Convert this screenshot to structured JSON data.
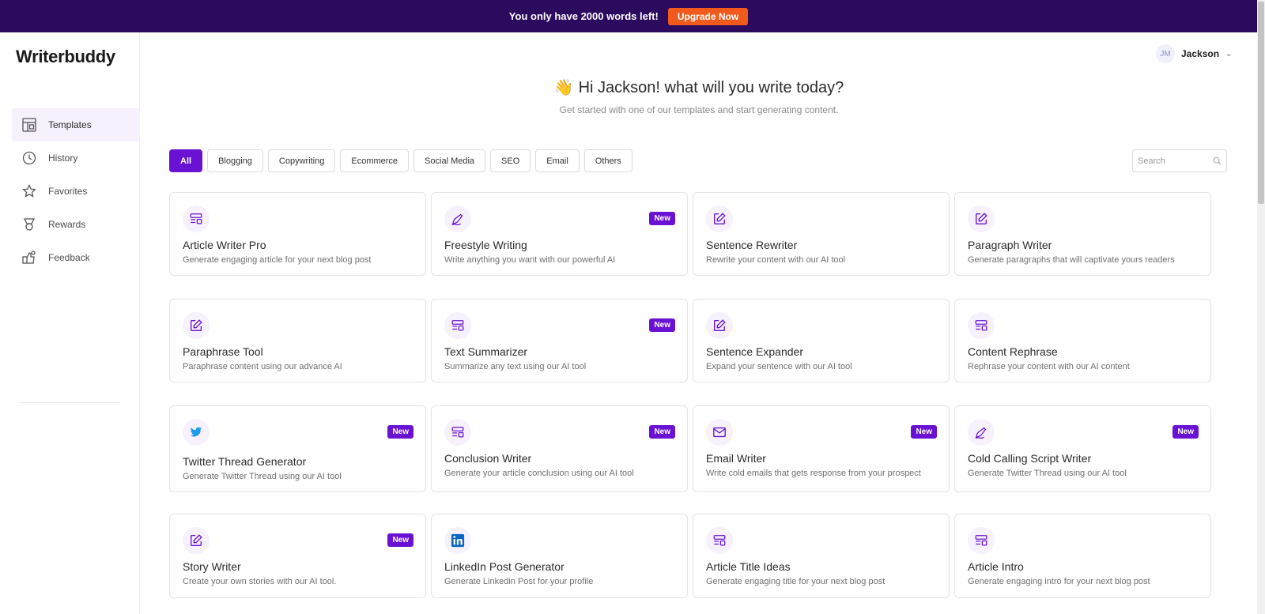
{
  "banner": {
    "message": "You only have 2000 words left!",
    "cta": "Upgrade Now"
  },
  "brand": {
    "name": "Writerbuddy"
  },
  "nav": [
    {
      "label": "Templates",
      "icon": "templates-icon"
    },
    {
      "label": "History",
      "icon": "history-icon"
    },
    {
      "label": "Favorites",
      "icon": "star-icon"
    },
    {
      "label": "Rewards",
      "icon": "medal-icon"
    },
    {
      "label": "Feedback",
      "icon": "feedback-icon"
    }
  ],
  "user": {
    "initials": "JM",
    "name": "Jackson"
  },
  "hero": {
    "wave": "👋",
    "title": "Hi Jackson! what will you write today?",
    "subtitle": "Get started with one of our templates and start generating content."
  },
  "filters": [
    "All",
    "Blogging",
    "Copywriting",
    "Ecommerce",
    "Social Media",
    "SEO",
    "Email",
    "Others"
  ],
  "search": {
    "placeholder": "Search"
  },
  "badge_label": "New",
  "cards": [
    {
      "title": "Article Writer Pro",
      "desc": "Generate engaging article for your next blog post",
      "icon": "layout-icon",
      "new": false
    },
    {
      "title": "Freestyle Writing",
      "desc": "Write anything you want with our powerful AI",
      "icon": "pen-nib-icon",
      "new": true
    },
    {
      "title": "Sentence Rewriter",
      "desc": "Rewrite your content with our AI tool",
      "icon": "edit-icon",
      "new": false
    },
    {
      "title": "Paragraph Writer",
      "desc": "Generate paragraphs that will captivate yours readers",
      "icon": "edit-icon",
      "new": false
    },
    {
      "title": "Paraphrase Tool",
      "desc": "Paraphrase content using our advance AI",
      "icon": "edit-icon",
      "new": false
    },
    {
      "title": "Text Summarizer",
      "desc": "Summarize any text using our AI tool",
      "icon": "layout-icon",
      "new": true
    },
    {
      "title": "Sentence Expander",
      "desc": "Expand your sentence with our AI tool",
      "icon": "edit-icon",
      "new": false
    },
    {
      "title": "Content Rephrase",
      "desc": "Rephrase your content with our AI content",
      "icon": "layout-icon",
      "new": false
    },
    {
      "title": "Twitter Thread Generator",
      "desc": "Generate Twitter Thread using our AI tool",
      "icon": "twitter-icon",
      "new": true
    },
    {
      "title": "Conclusion Writer",
      "desc": "Generate your article conclusion using our AI tool",
      "icon": "layout-icon",
      "new": true
    },
    {
      "title": "Email Writer",
      "desc": "Write cold emails that gets response from your prospect",
      "icon": "mail-icon",
      "new": true
    },
    {
      "title": "Cold Calling Script Writer",
      "desc": "Generate Twitter Thread using our AI tool",
      "icon": "pen-nib-icon",
      "new": true
    },
    {
      "title": "Story Writer",
      "desc": "Create your own stories with our AI tool.",
      "icon": "edit-icon",
      "new": true
    },
    {
      "title": "LinkedIn Post Generator",
      "desc": "Generate Linkedin Post for your profile",
      "icon": "linkedin-icon",
      "new": false
    },
    {
      "title": "Article Title Ideas",
      "desc": "Generate engaging title for your next blog post",
      "icon": "layout-icon",
      "new": false
    },
    {
      "title": "Article Intro",
      "desc": "Generate engaging intro for your next blog post",
      "icon": "layout-icon",
      "new": false
    }
  ],
  "colors": {
    "brand": "#6a12d3",
    "banner_bg": "#2c0a5e",
    "cta": "#f25a1d"
  }
}
